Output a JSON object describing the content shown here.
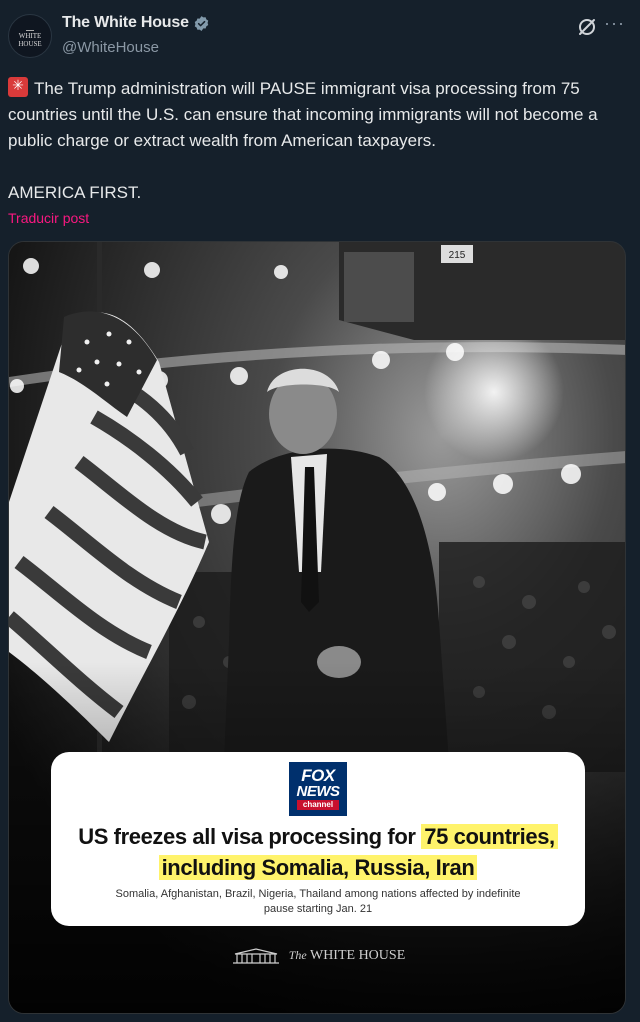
{
  "account": {
    "display_name": "The White House",
    "handle": "@WhiteHouse",
    "avatar_text_line1": "WHITE",
    "avatar_text_line2": "HOUSE"
  },
  "tweet": {
    "text": "The Trump administration will PAUSE immigrant visa processing from 75 countries until the U.S. can ensure that incoming immigrants will not become a public charge or extract wealth from American taxpayers.",
    "tagline": "AMERICA FIRST.",
    "translate_label": "Traducir post",
    "emoji_icon": "siren-icon"
  },
  "media": {
    "stage_sign": "215",
    "news_logo": {
      "line1": "FOX",
      "line2": "NEWS",
      "line3": "channel"
    },
    "headline_plain": "US freezes all visa processing for ",
    "headline_highlight1": "75 countries,",
    "headline_highlight2": "including Somalia, Russia, Iran",
    "subhead": "Somalia, Afghanistan, Brazil, Nigeria, Thailand among nations affected by indefinite pause starting Jan. 21",
    "footer_prefix": "The",
    "footer_label": "WHITE HOUSE"
  },
  "colors": {
    "background": "#15202b",
    "link": "#f91880",
    "verified": "#829aab",
    "highlight": "#fff36b",
    "fox_blue": "#00306d"
  }
}
